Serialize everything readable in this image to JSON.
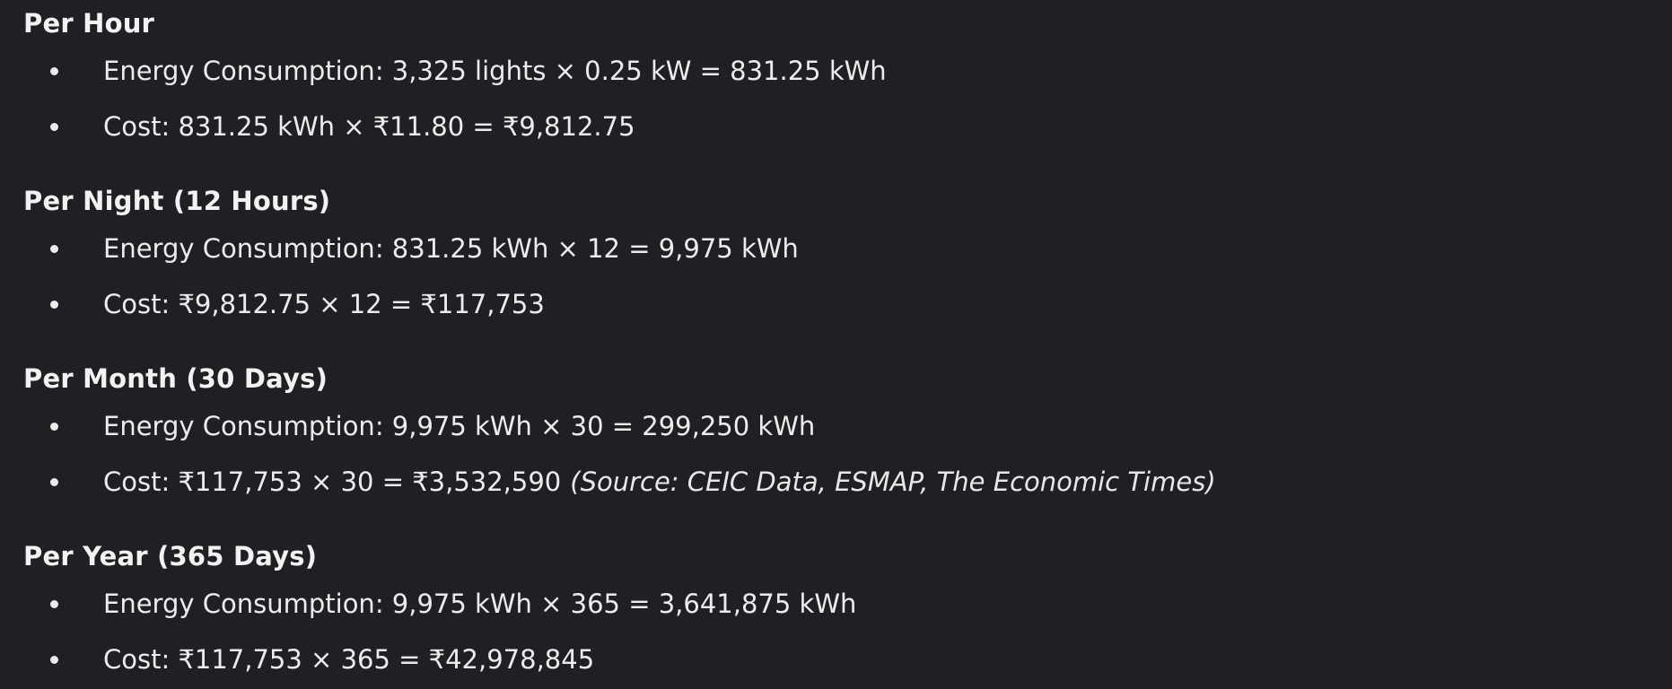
{
  "sections": [
    {
      "heading": "Per Hour",
      "items": [
        {
          "text": "Energy Consumption: 3,325 lights × 0.25 kW = 831.25 kWh"
        },
        {
          "text": "Cost: 831.25 kWh × ₹11.80 = ₹9,812.75"
        }
      ]
    },
    {
      "heading": "Per Night (12 Hours)",
      "items": [
        {
          "text": "Energy Consumption: 831.25 kWh × 12 = 9,975 kWh"
        },
        {
          "text": "Cost: ₹9,812.75 × 12 = ₹117,753"
        }
      ]
    },
    {
      "heading": "Per Month (30 Days)",
      "items": [
        {
          "text": "Energy Consumption: 9,975 kWh × 30 = 299,250 kWh"
        },
        {
          "text": "Cost: ₹117,753 × 30 = ₹3,532,590",
          "source": "(Source: CEIC Data, ESMAP, The Economic Times)"
        }
      ]
    },
    {
      "heading": "Per Year (365 Days)",
      "items": [
        {
          "text": "Energy Consumption: 9,975 kWh × 365 = 3,641,875 kWh"
        },
        {
          "text": "Cost: ₹117,753 × 365 = ₹42,978,845"
        }
      ]
    }
  ]
}
